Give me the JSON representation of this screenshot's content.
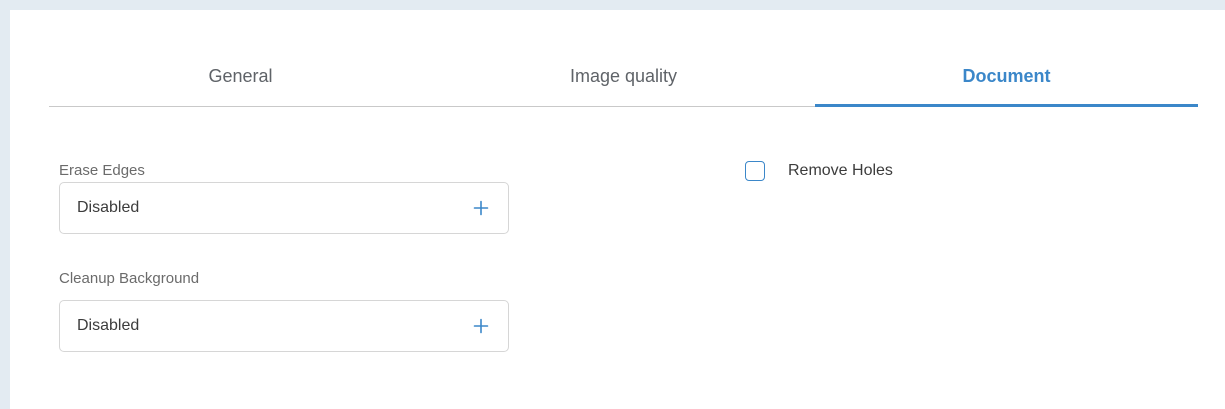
{
  "tabs": [
    {
      "label": "General",
      "active": false
    },
    {
      "label": "Image quality",
      "active": false
    },
    {
      "label": "Document",
      "active": true
    }
  ],
  "document": {
    "erase_edges": {
      "label": "Erase Edges",
      "value": "Disabled",
      "action_icon": "plus-icon"
    },
    "cleanup_background": {
      "label": "Cleanup Background",
      "value": "Disabled",
      "action_icon": "plus-icon"
    },
    "remove_holes": {
      "label": "Remove Holes",
      "checked": false
    }
  },
  "colors": {
    "accent": "#3b87c9",
    "frame": "#e3ebf2",
    "divider": "#c9c9c9",
    "field_border": "#d6d6d6"
  }
}
